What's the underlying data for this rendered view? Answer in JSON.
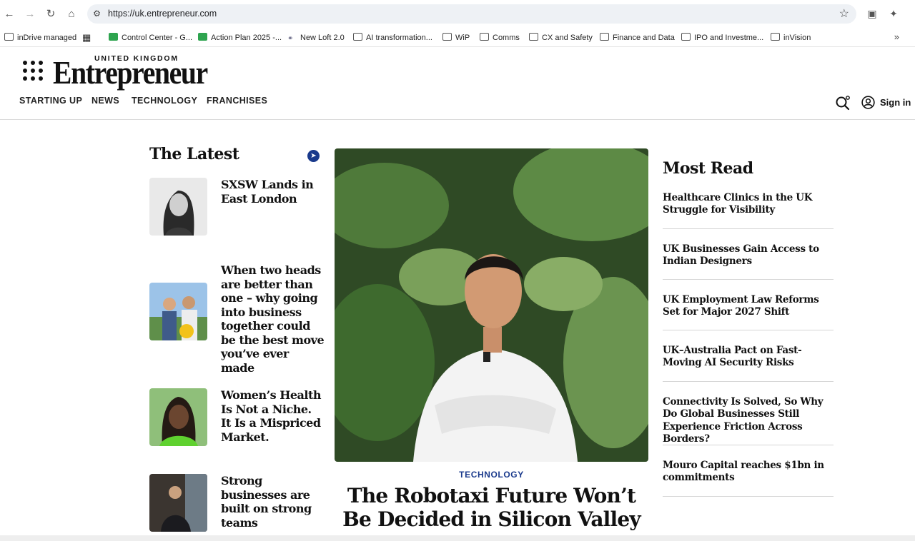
{
  "browser": {
    "url": "https://uk.entrepreneur.com",
    "bookmarks": [
      {
        "label": "inDrive managed",
        "icon": "folder-icon"
      },
      {
        "label": "",
        "icon": "apps-grid-icon"
      },
      {
        "label": "Control Center - G...",
        "icon": "sheet-icon"
      },
      {
        "label": "Action Plan 2025 -...",
        "icon": "sheet-icon"
      },
      {
        "label": "New Loft 2.0",
        "icon": "link-icon"
      },
      {
        "label": "AI transformation...",
        "icon": "folder-icon"
      },
      {
        "label": "WiP",
        "icon": "folder-icon"
      },
      {
        "label": "Comms",
        "icon": "folder-icon"
      },
      {
        "label": "CX and Safety",
        "icon": "folder-icon"
      },
      {
        "label": "Finance and Data",
        "icon": "folder-icon"
      },
      {
        "label": "IPO and Investme...",
        "icon": "folder-icon"
      },
      {
        "label": "inVision",
        "icon": "folder-icon"
      }
    ]
  },
  "site": {
    "logo_region": "UNITED KINGDOM",
    "logo_name": "Entrepreneur",
    "nav": [
      "STARTING UP",
      "NEWS",
      "TECHNOLOGY",
      "FRANCHISES"
    ],
    "sign_in": "Sign in",
    "brand_blue": "#1a3a8c"
  },
  "latest": {
    "title": "The Latest",
    "stories": [
      {
        "headline": "SXSW Lands in East London"
      },
      {
        "headline": "When two heads are better than one – why going into business together could be the best move you’ve ever made"
      },
      {
        "headline": "Women’s Health Is Not a Niche. It Is a Mispriced Market."
      },
      {
        "headline": "Strong businesses are built on strong teams"
      }
    ]
  },
  "hero": {
    "category": "TECHNOLOGY",
    "title": "The Robotaxi Future Won’t Be Decided in Silicon Valley"
  },
  "most_read": {
    "title": "Most Read",
    "items": [
      "Healthcare Clinics in the UK Struggle for Visibility",
      "UK Businesses Gain Access to Indian Designers",
      "UK Employment Law Reforms Set for Major 2027 Shift",
      "UK–Australia Pact on Fast-Moving AI Security Risks",
      "Connectivity Is Solved, So Why Do Global Businesses Still Experience Friction Across Borders?",
      "Mouro Capital reaches $1bn in commitments"
    ]
  }
}
